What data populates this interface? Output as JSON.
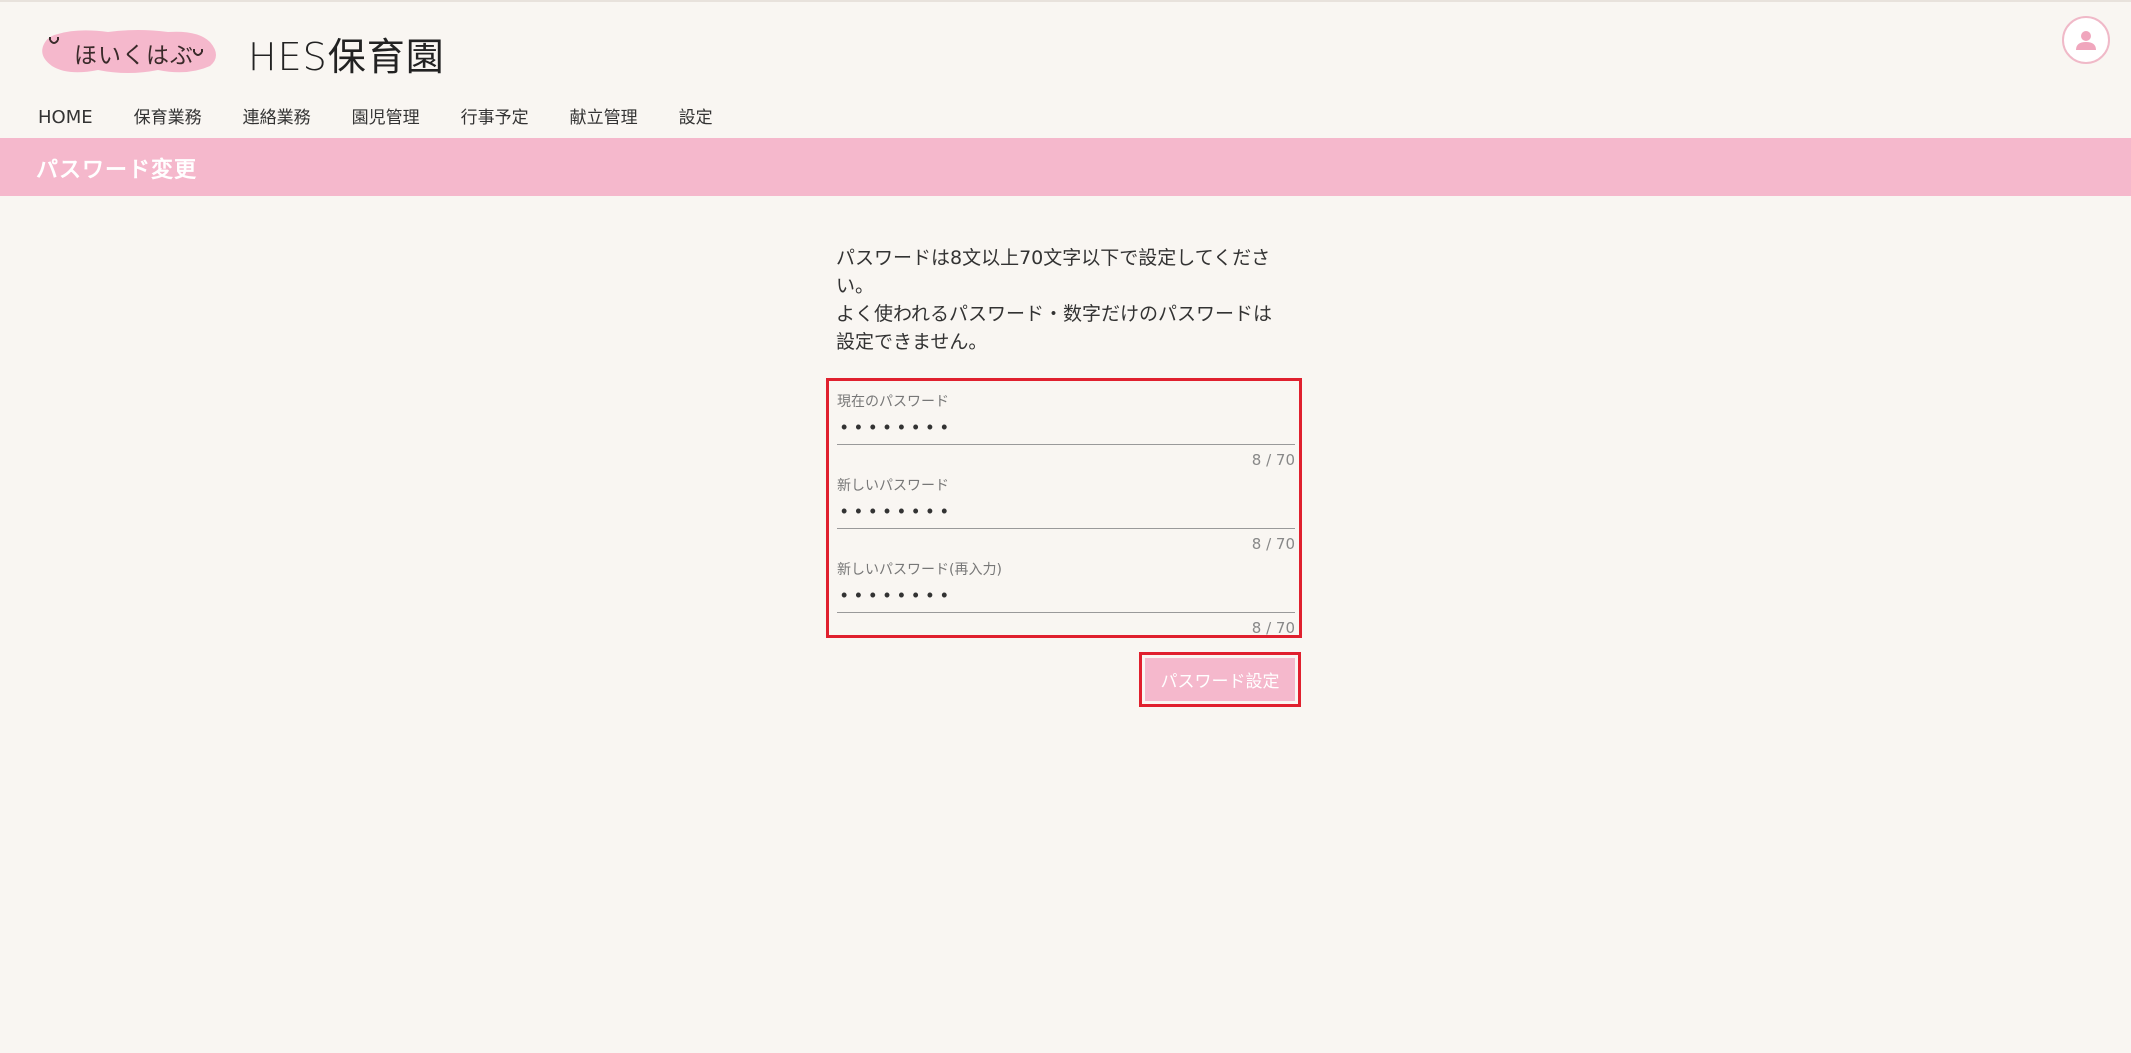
{
  "header": {
    "logo_text": "ほいくはぶ",
    "site_title": "HES保育園"
  },
  "nav": {
    "items": [
      {
        "label": "HOME"
      },
      {
        "label": "保育業務"
      },
      {
        "label": "連絡業務"
      },
      {
        "label": "園児管理"
      },
      {
        "label": "行事予定"
      },
      {
        "label": "献立管理"
      },
      {
        "label": "設定"
      }
    ]
  },
  "page": {
    "title": "パスワード変更",
    "instructions_line1": "パスワードは8文以上70文字以下で設定してください。",
    "instructions_line2": "よく使われるパスワード・数字だけのパスワードは設定できません。"
  },
  "form": {
    "fields": [
      {
        "label": "現在のパスワード",
        "value": "••••••••",
        "count": "8 / 70"
      },
      {
        "label": "新しいパスワード",
        "value": "••••••••",
        "count": "8 / 70"
      },
      {
        "label": "新しいパスワード(再入力)",
        "value": "••••••••",
        "count": "8 / 70"
      }
    ],
    "submit_label": "パスワード設定"
  },
  "colors": {
    "brand_pink": "#f5b8cc",
    "highlight_red": "#e0202e",
    "background": "#f9f6f2"
  }
}
